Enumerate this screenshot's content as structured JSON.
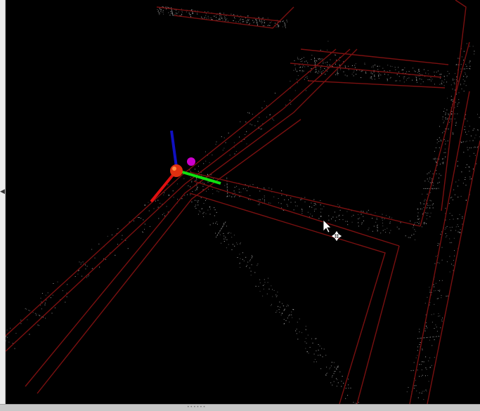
{
  "window": {
    "collapse_icon": "chevron-left-icon",
    "splitter_icon": "grip-dots-icon"
  },
  "viewport": {
    "background_color": "#000000",
    "cloud_color": "#cfcfcf",
    "map_outline_color": "#7a1010",
    "axes": {
      "x_color": "#e01010",
      "y_color": "#10e010",
      "z_color": "#1010c0",
      "origin_color": "#e03010",
      "goal_marker_color": "#cc00cc"
    },
    "cursor_icon": "arrow-cursor-icon",
    "move_tool_icon": "move-cross-icon"
  }
}
